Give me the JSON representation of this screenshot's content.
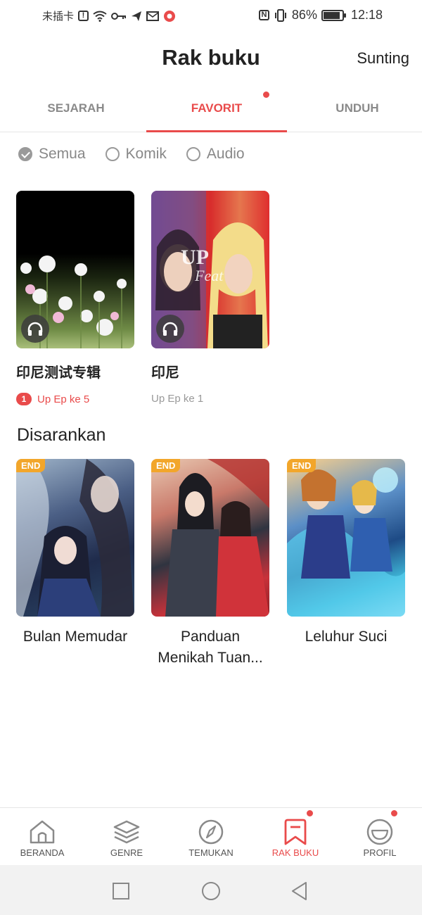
{
  "status_bar": {
    "carrier": "未插卡",
    "battery": "86%",
    "time": "12:18"
  },
  "header": {
    "title": "Rak buku",
    "edit_label": "Sunting"
  },
  "tabs": [
    {
      "label": "SEJARAH"
    },
    {
      "label": "FAVORIT"
    },
    {
      "label": "UNDUH"
    }
  ],
  "filters": [
    {
      "label": "Semua",
      "checked": true
    },
    {
      "label": "Komik",
      "checked": false
    },
    {
      "label": "Audio",
      "checked": false
    }
  ],
  "favorites": [
    {
      "title": "印尼测试专辑",
      "subtitle": "Up Ep ke 5",
      "badge": "1",
      "icon": "headphones-icon"
    },
    {
      "title": "印尼",
      "subtitle": "Up Ep ke 1",
      "icon": "headphones-icon"
    }
  ],
  "suggested": {
    "title": "Disarankan",
    "items": [
      {
        "title": "Bulan Memudar",
        "tag": "END"
      },
      {
        "title": "Panduan Menikah Tuan...",
        "tag": "END"
      },
      {
        "title": "Leluhur Suci",
        "tag": "END"
      }
    ]
  },
  "bottom_nav": [
    {
      "label": "BERANDA",
      "icon": "home-icon"
    },
    {
      "label": "GENRE",
      "icon": "layers-icon"
    },
    {
      "label": "TEMUKAN",
      "icon": "compass-icon"
    },
    {
      "label": "RAK BUKU",
      "icon": "bookmark-icon"
    },
    {
      "label": "PROFIL",
      "icon": "profile-icon"
    }
  ],
  "colors": {
    "accent": "#e94b4b",
    "end_tag": "#f2a62b"
  }
}
